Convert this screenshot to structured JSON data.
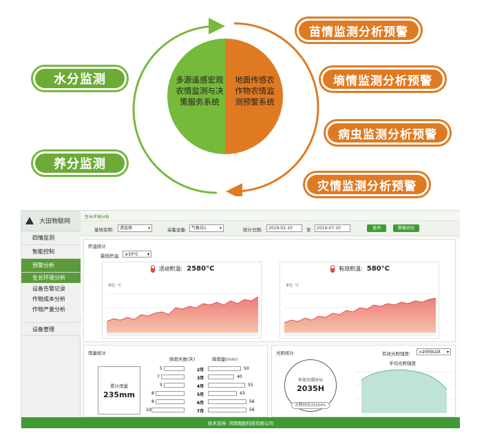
{
  "circle": {
    "left_text": "多源遥感宏观农情监测与决策服务系统",
    "right_text": "地面传感农作物农情监测预警系统"
  },
  "left_pills": [
    "水分监测",
    "养分监测"
  ],
  "right_pills": [
    "苗情监测分析预警",
    "墒情监测分析预警",
    "病虫监测分析预警",
    "灾情监测分析预警"
  ],
  "colors": {
    "green": "#76b93b",
    "orange": "#e07a22",
    "app_green": "#3f9a35"
  },
  "app": {
    "brand": "大田物联网",
    "nav": [
      {
        "label": "四情监测",
        "active": false
      },
      {
        "label": "智能控制",
        "active": false
      },
      {
        "label": "预警分析",
        "active": true
      }
    ],
    "subnav": [
      {
        "label": "生长环境分析",
        "active": true
      },
      {
        "label": "设备告警记录",
        "active": false
      },
      {
        "label": "作物成本分析",
        "active": false
      },
      {
        "label": "作物产量分析",
        "active": false
      }
    ],
    "device_mgmt": "设备管理",
    "breadcrumb": "生长环境分析",
    "filters": {
      "base_label": "基地名称:",
      "base_value": "请选择",
      "device_label": "采集设备:",
      "device_value": "气象站1",
      "date_label": "统计日期:",
      "date_from": "2019-02-10",
      "to_label": "至",
      "date_to": "2019-07-10",
      "query_btn": "查询",
      "compare_btn": "数据对比"
    },
    "accum": {
      "title": "积温统计",
      "threshold_label": "最低积温:",
      "threshold_value": "≥10°C",
      "active_label": "活动积温:",
      "active_value": "2580°C",
      "effective_label": "有效积温:",
      "effective_value": "580°C",
      "unit_label": "单位: °C"
    },
    "rain": {
      "title": "雨量统计",
      "days_header": "降雨天数(天)",
      "amount_header": "降雨量(mm)",
      "total_label": "累计雨量",
      "total_value": "235mm",
      "months": [
        "2月",
        "3月",
        "4月",
        "5月",
        "6月",
        "7月"
      ],
      "days": [
        5,
        7,
        5,
        8,
        8,
        10
      ],
      "amounts": [
        50,
        40,
        55,
        43,
        56,
        56
      ]
    },
    "light": {
      "title": "光照统计",
      "intensity_label": "有效光照强度:",
      "intensity_value": ">2000LUX",
      "chart_title": "平均光照强度",
      "effective_label": "有效光照时长",
      "effective_value": "2035H",
      "ratio_label": "光照时间占比64%"
    },
    "footer": "技术支持: 河南图胜科技有限公司"
  }
}
